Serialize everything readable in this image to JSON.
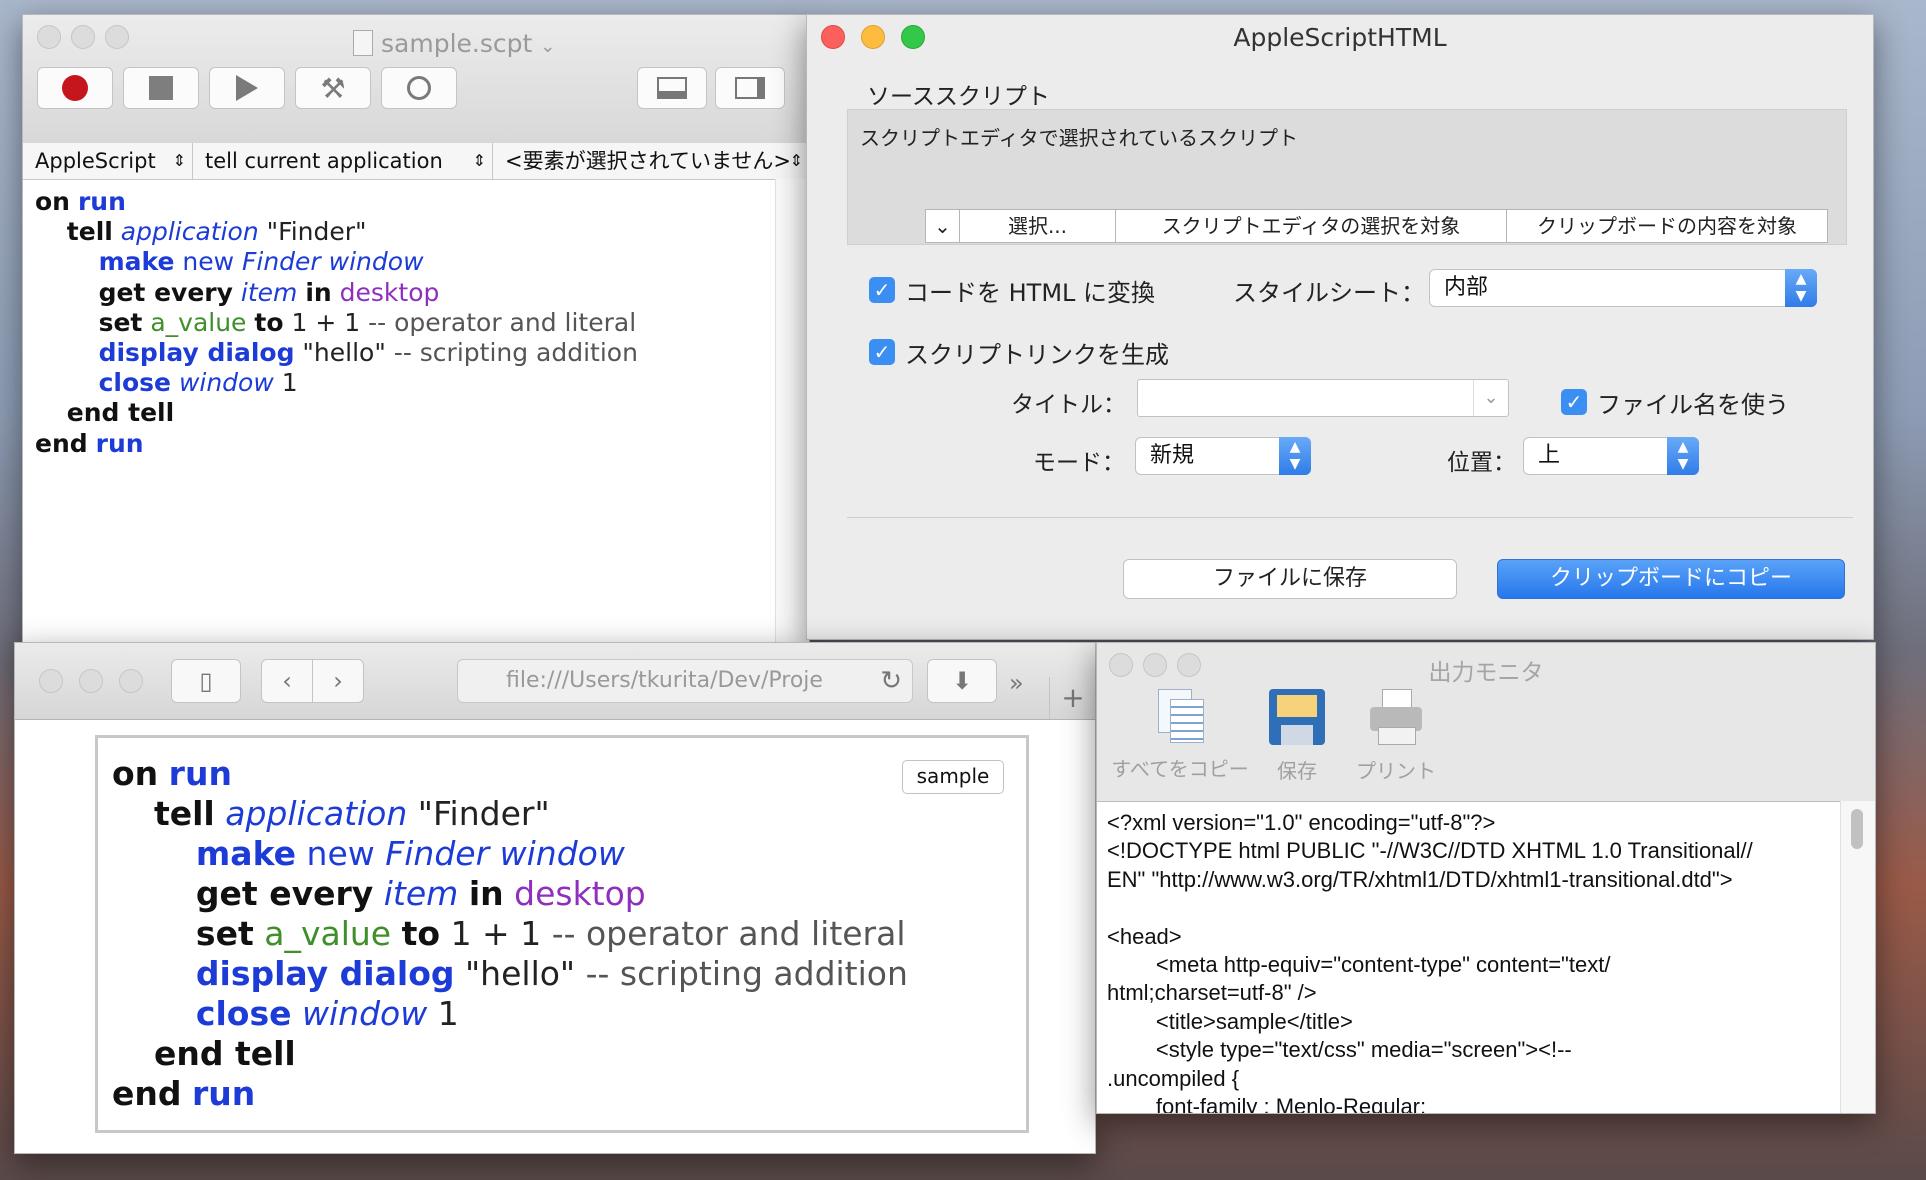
{
  "editor": {
    "title": "sample.scpt",
    "popups": [
      "AppleScript",
      "tell current application",
      "<要素が選択されていません>"
    ],
    "toolbar": [
      "record-button",
      "stop-button",
      "run-button",
      "compile-button",
      "log-button",
      "split-view-button",
      "sidebar-button"
    ]
  },
  "code": {
    "l1": [
      "on",
      "run"
    ],
    "l2": [
      "tell",
      "application",
      "\"Finder\""
    ],
    "l3": [
      "make",
      "new",
      "Finder window"
    ],
    "l4": [
      "get every",
      "item",
      "in",
      "desktop"
    ],
    "l5": [
      "set",
      "a_value",
      "to",
      "1 + 1",
      "-- operator and literal"
    ],
    "l6": [
      "display dialog",
      "\"hello\"",
      "-- scripting addition"
    ],
    "l7": [
      "close",
      "window",
      "1"
    ],
    "l8": [
      "end tell"
    ],
    "l9": [
      "end",
      "run"
    ]
  },
  "dialog": {
    "title": "AppleScriptHTML",
    "source_label": "ソーススクリプト",
    "source_text": "スクリプトエディタで選択されているスクリプト",
    "seg_select": "選択...",
    "seg_editor": "スクリプトエディタの選択を対象",
    "seg_clipboard": "クリップボードの内容を対象",
    "convert_label": "コードを HTML に変換",
    "stylesheet_label": "スタイルシート：",
    "stylesheet_value": "内部",
    "link_label": "スクリプトリンクを生成",
    "title_label": "タイトル：",
    "title_value": "",
    "use_filename_label": "ファイル名を使う",
    "mode_label": "モード：",
    "mode_value": "新規",
    "position_label": "位置：",
    "position_value": "上",
    "save_button": "ファイルに保存",
    "copy_button": "クリップボードにコピー"
  },
  "safari": {
    "url": "file:///Users/tkurita/Dev/Proje",
    "sample_button": "sample"
  },
  "monitor": {
    "title": "出力モニタ",
    "copy_all": "すべてをコピー",
    "save": "保存",
    "print": "プリント",
    "output_lines": [
      "<?xml version=\"1.0\" encoding=\"utf-8\"?>",
      "<!DOCTYPE html PUBLIC \"-//W3C//DTD XHTML 1.0 Transitional//",
      "EN\" \"http://www.w3.org/TR/xhtml1/DTD/xhtml1-transitional.dtd\">",
      "",
      "<head>",
      "        <meta http-equiv=\"content-type\" content=\"text/",
      "html;charset=utf-8\" />",
      "        <title>sample</title>",
      "        <style type=\"text/css\" media=\"screen\"><!--",
      ".uncompiled {",
      "        font-family : Menlo-Regular;"
    ]
  },
  "colors": {
    "keyword_blue": "#1d3bd6",
    "var_green": "#3f8f2a",
    "class_purple": "#8e2fbe",
    "accent": "#3b8ff3"
  }
}
